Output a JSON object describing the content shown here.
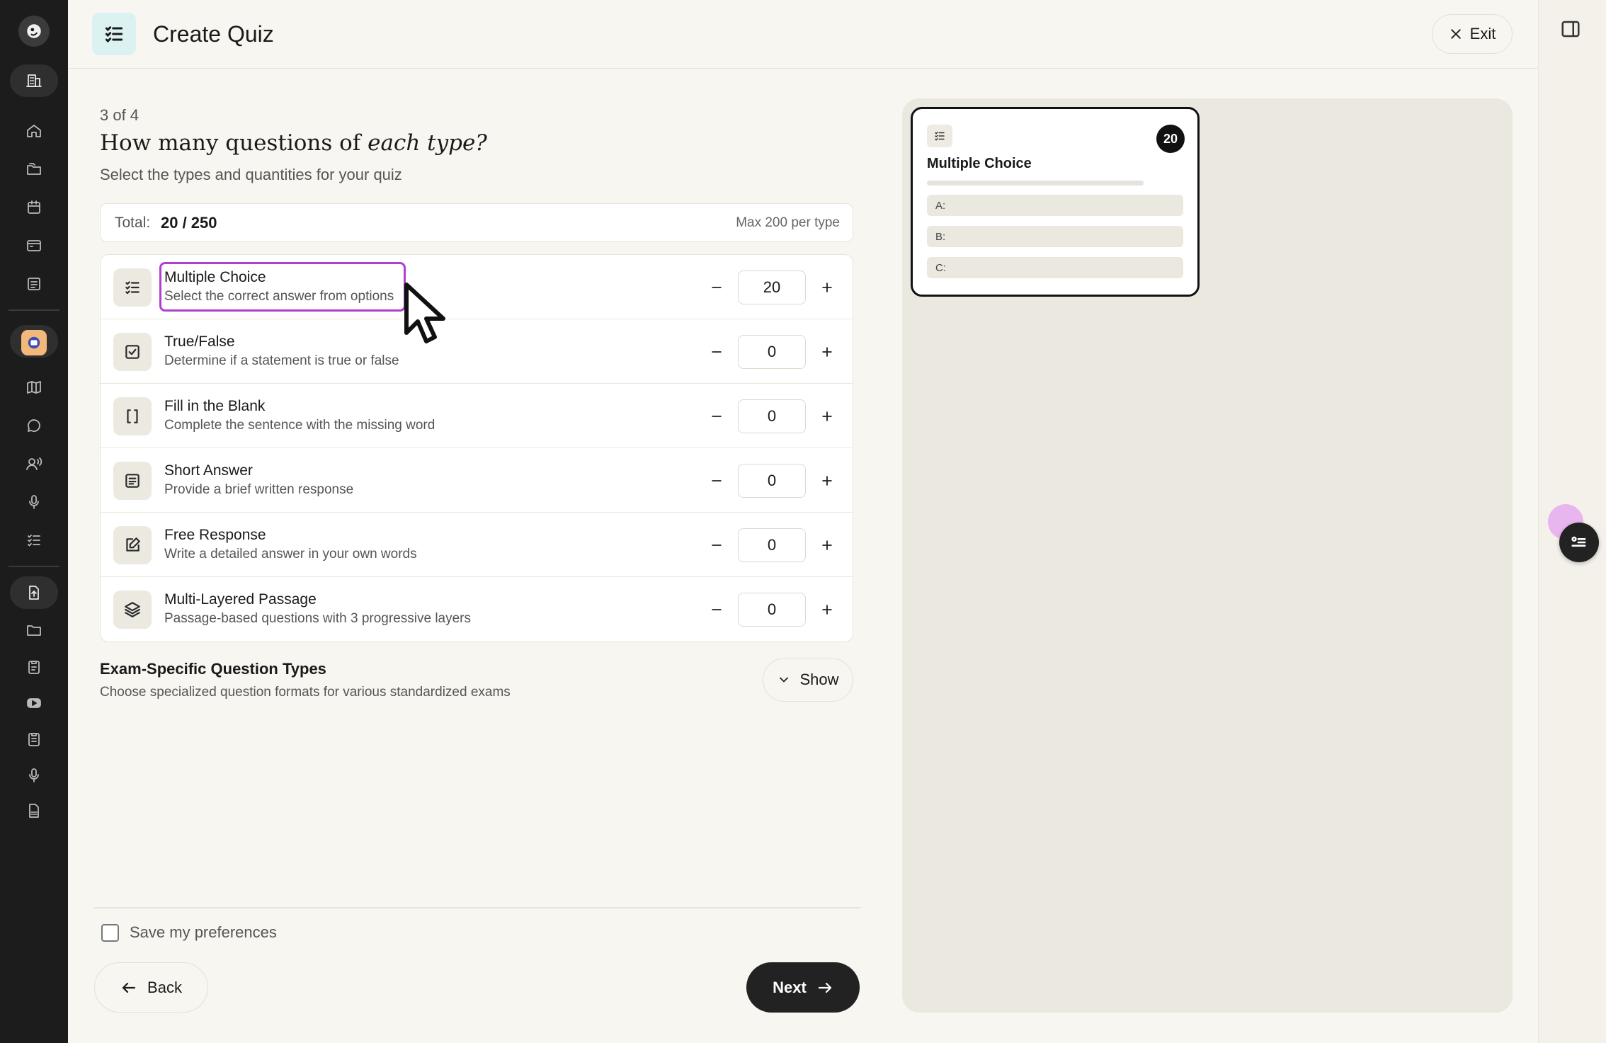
{
  "header": {
    "title": "Create Quiz",
    "exit_label": "Exit"
  },
  "step": {
    "label": "3 of 4",
    "question_prefix": "How many questions of ",
    "question_emphasis": "each type?",
    "subtitle": "Select the types and quantities for your quiz"
  },
  "totals": {
    "label": "Total:",
    "value": "20 / 250",
    "max_note": "Max 200 per type"
  },
  "question_types": [
    {
      "name": "Multiple Choice",
      "description": "Select the correct answer from options",
      "count": "20",
      "icon": "list-check-icon"
    },
    {
      "name": "True/False",
      "description": "Determine if a statement is true or false",
      "count": "0",
      "icon": "checkbox-icon"
    },
    {
      "name": "Fill in the Blank",
      "description": "Complete the sentence with the missing word",
      "count": "0",
      "icon": "brackets-icon"
    },
    {
      "name": "Short Answer",
      "description": "Provide a brief written response",
      "count": "0",
      "icon": "text-lines-icon"
    },
    {
      "name": "Free Response",
      "description": "Write a detailed answer in your own words",
      "count": "0",
      "icon": "edit-square-icon"
    },
    {
      "name": "Multi-Layered Passage",
      "description": "Passage-based questions with 3 progressive layers",
      "count": "0",
      "icon": "layers-icon"
    }
  ],
  "exam_section": {
    "title": "Exam-Specific Question Types",
    "description": "Choose specialized question formats for various standardized exams",
    "toggle_label": "Show"
  },
  "footer": {
    "save_preferences_label": "Save my preferences",
    "back_label": "Back",
    "next_label": "Next"
  },
  "preview": {
    "title": "Multiple Choice",
    "badge": "20",
    "options": [
      "A:",
      "B:",
      "C:"
    ]
  },
  "colors": {
    "highlight": "#b03fd1",
    "primary_button": "#222222",
    "sidebar": "#1c1c1c",
    "title_icon_bg": "#dcf1f1"
  }
}
